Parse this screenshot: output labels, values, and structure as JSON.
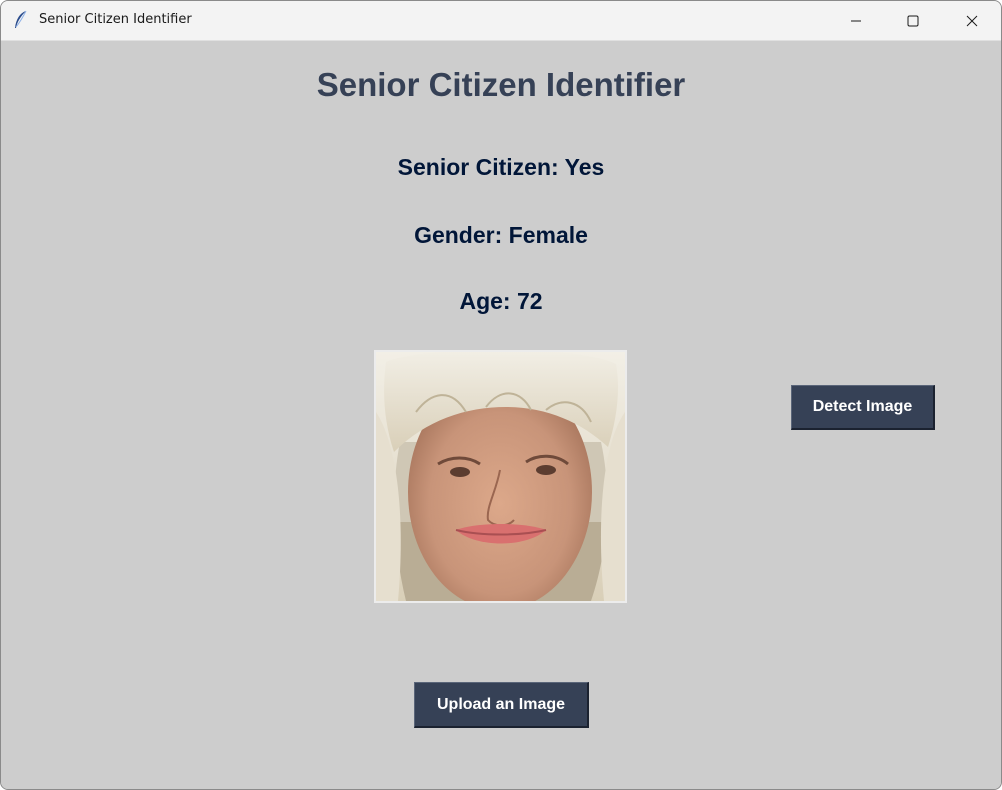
{
  "window": {
    "title": "Senior Citizen Identifier",
    "controls": {
      "minimize": "minimize-icon",
      "maximize": "maximize-icon",
      "close": "close-icon"
    }
  },
  "main": {
    "heading": "Senior Citizen Identifier",
    "senior_label": "Senior Citizen: Yes",
    "gender_label": "Gender: Female",
    "age_label": "Age: 72",
    "photo_alt": "uploaded face photo",
    "detect_button": "Detect Image",
    "upload_button": "Upload an Image"
  },
  "colors": {
    "background": "#cdcdcd",
    "heading": "#364156",
    "info_text": "#011638",
    "button": "#364156",
    "button_text": "#ffffff"
  }
}
